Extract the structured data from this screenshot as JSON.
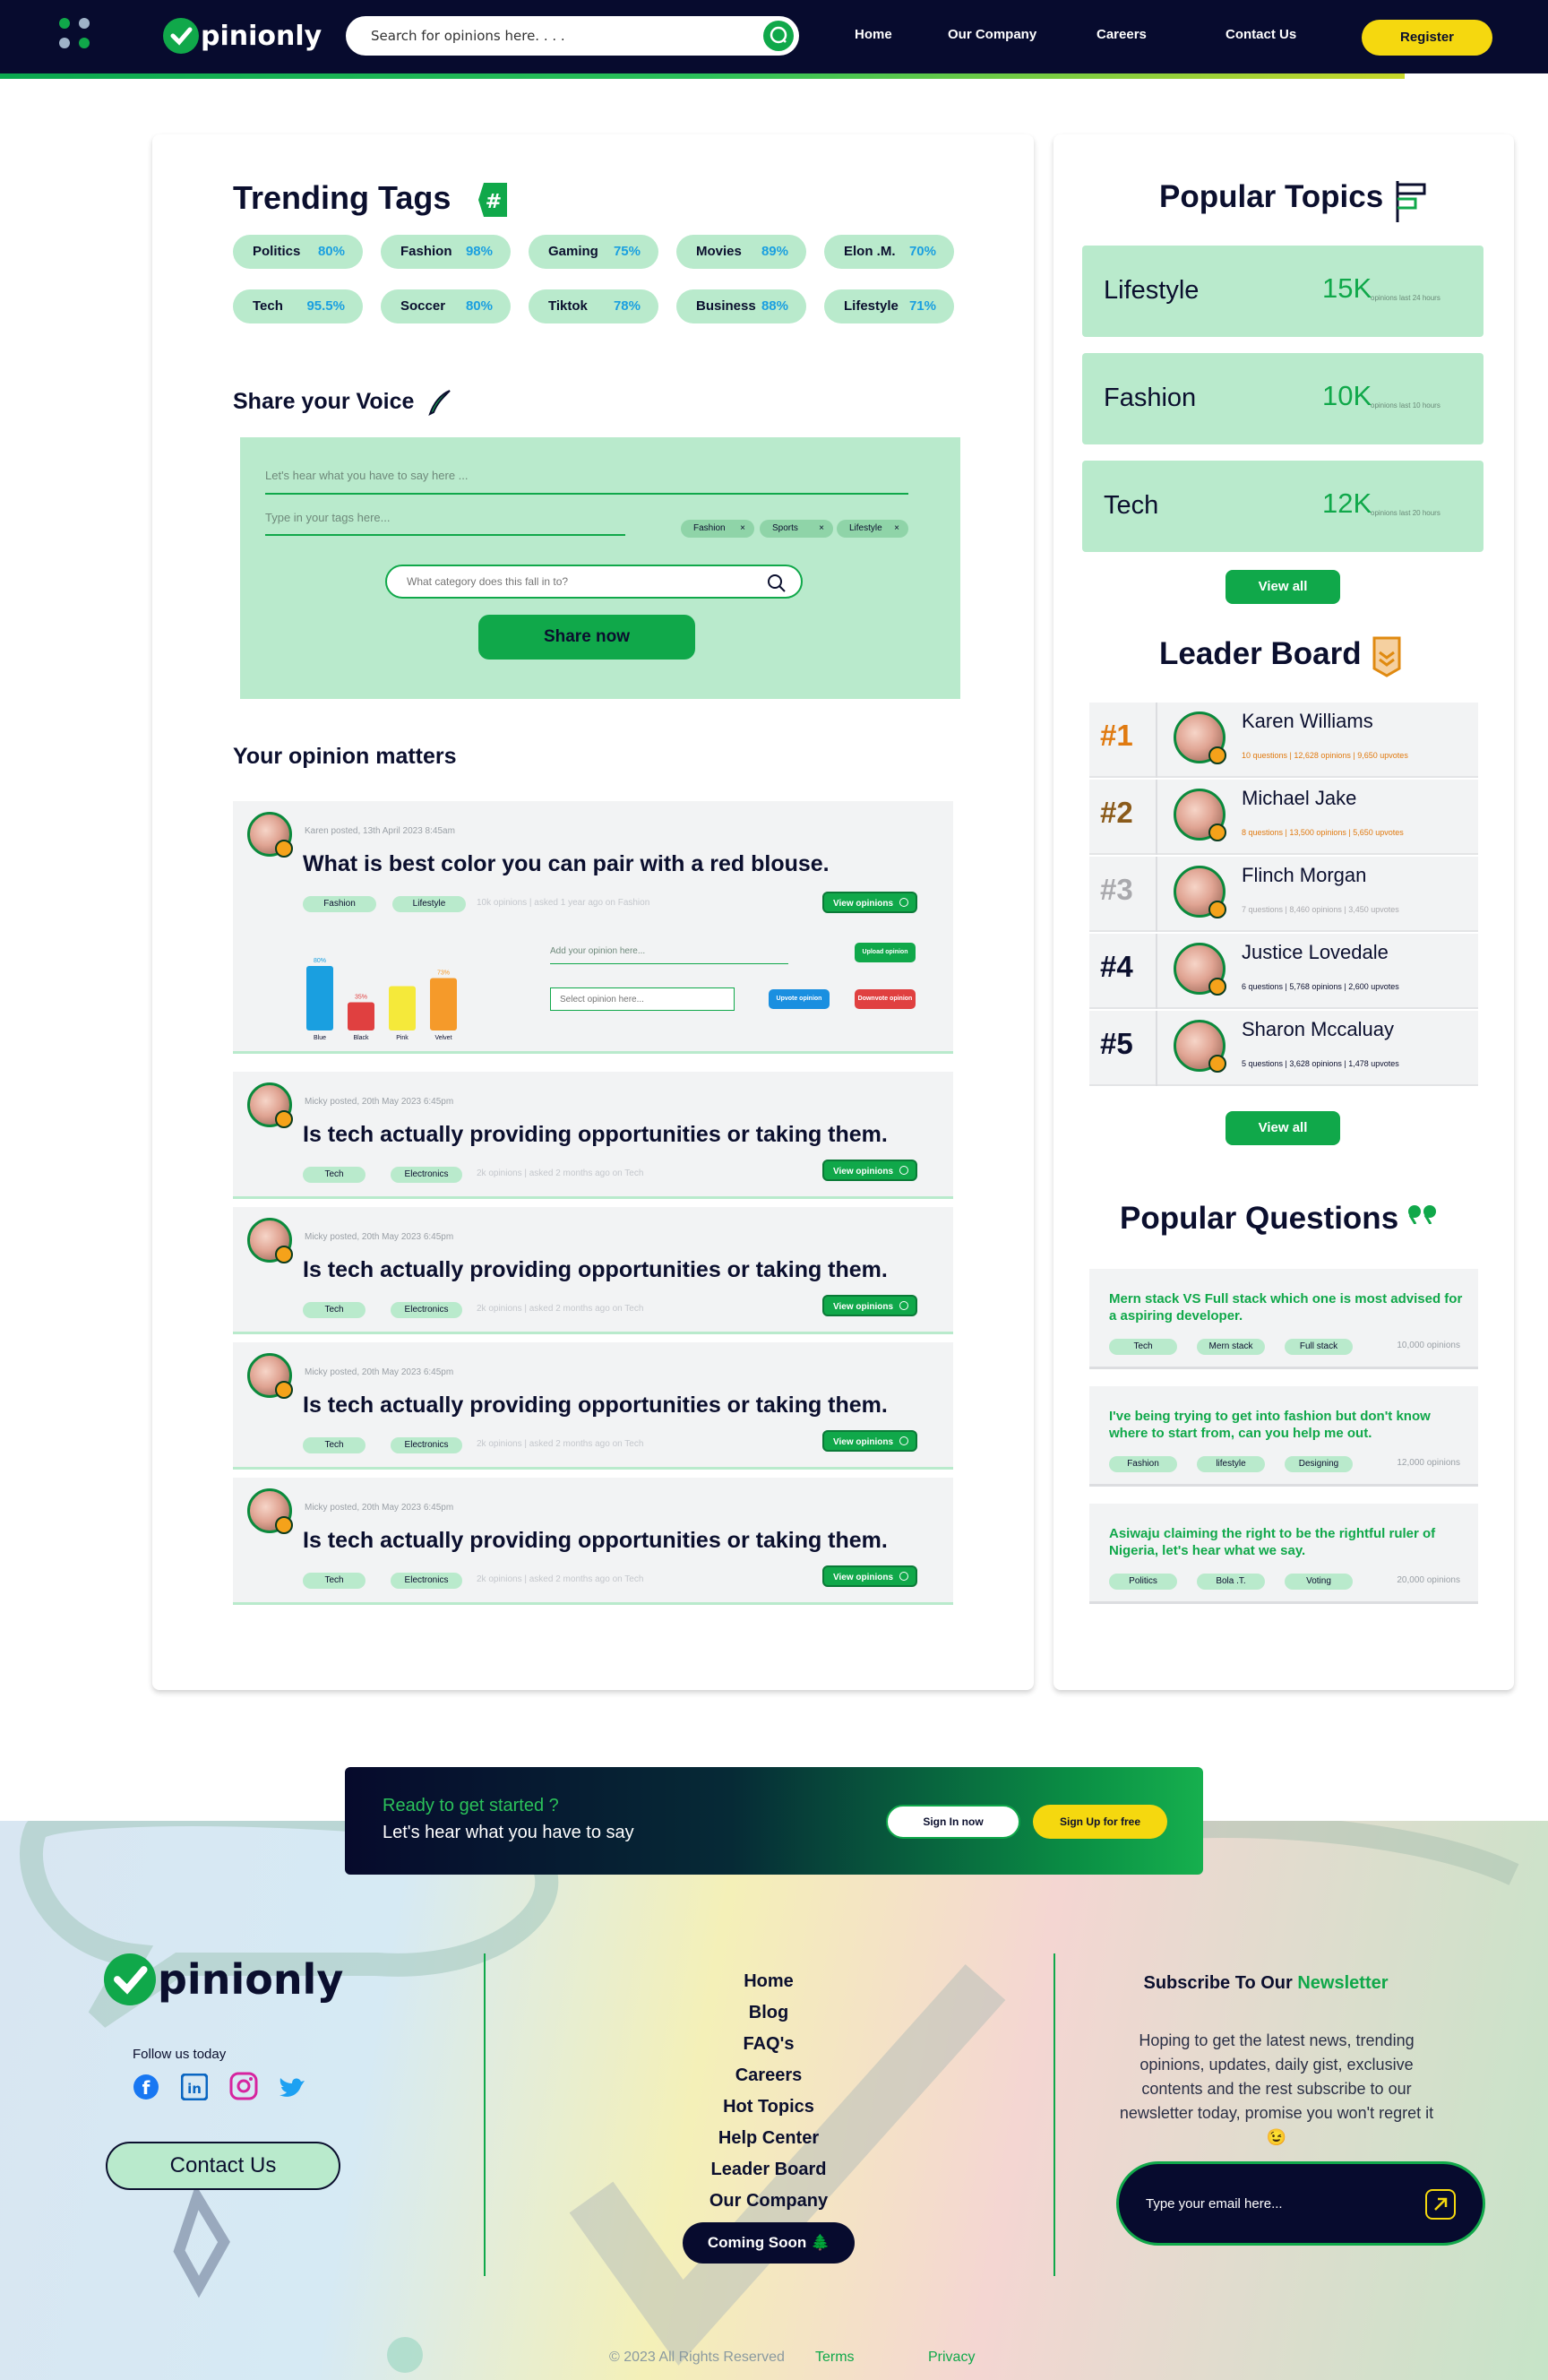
{
  "nav": {
    "brand": "pinionly",
    "search_placeholder": "Search for opinions here. . . .",
    "links": [
      "Home",
      "Our Company",
      "Careers",
      "Contact Us"
    ],
    "register": "Register",
    "accent": "#10a84a",
    "yellow": "#f5d80f",
    "dark": "#070b2e"
  },
  "trending": {
    "title": "Trending Tags",
    "title_icon": "hashtag-icon",
    "tags": [
      {
        "name": "Politics",
        "pct": "80%"
      },
      {
        "name": "Fashion",
        "pct": "98%"
      },
      {
        "name": "Gaming",
        "pct": "75%"
      },
      {
        "name": "Movies",
        "pct": "89%"
      },
      {
        "name": "Elon .M.",
        "pct": "70%"
      },
      {
        "name": "Tech",
        "pct": "95.5%"
      },
      {
        "name": "Soccer",
        "pct": "80%"
      },
      {
        "name": "Tiktok",
        "pct": "78%"
      },
      {
        "name": "Business",
        "pct": "88%"
      },
      {
        "name": "Lifestyle",
        "pct": "71%"
      }
    ]
  },
  "voice": {
    "title": "Share your Voice",
    "title_icon": "quill-pen-icon",
    "say_placeholder": "Let's hear what you have to say here ...",
    "tags_placeholder": "Type in your tags here...",
    "chips": [
      "Fashion",
      "Sports",
      "Lifestyle"
    ],
    "chip_close": "×",
    "category_placeholder": "What category does this fall in to?",
    "share": "Share now"
  },
  "opinions": {
    "title": "Your opinion matters",
    "first": {
      "meta": "Karen posted, 13th April 2023 8:45am",
      "question": "What is best color you can pair with a red blouse.",
      "tags": [
        "Fashion",
        "Lifestyle"
      ],
      "stats": "10k opinions | asked 1 year ago on Fashion",
      "view": "View opinions",
      "add_placeholder": "Add your opinion here...",
      "upload": "Upload opinion",
      "select_placeholder": "Select opinion here...",
      "upvote": "Upvote opinion",
      "downvote": "Downvote opinion"
    },
    "others": [
      {
        "meta": "Micky posted, 20th May 2023 6:45pm",
        "question": "Is tech actually providing opportunities or taking them.",
        "tags": [
          "Tech",
          "Electronics"
        ],
        "stats": "2k opinions | asked 2 months ago on Tech",
        "view": "View opinions"
      },
      {
        "meta": "Micky posted, 20th May 2023 6:45pm",
        "question": "Is tech actually providing opportunities or taking them.",
        "tags": [
          "Tech",
          "Electronics"
        ],
        "stats": "2k opinions | asked 2 months ago on Tech",
        "view": "View opinions"
      },
      {
        "meta": "Micky posted, 20th May 2023 6:45pm",
        "question": "Is tech actually providing opportunities or taking them.",
        "tags": [
          "Tech",
          "Electronics"
        ],
        "stats": "2k opinions | asked 2 months ago on Tech",
        "view": "View opinions"
      },
      {
        "meta": "Micky posted, 20th May 2023 6:45pm",
        "question": "Is tech actually providing opportunities or taking them.",
        "tags": [
          "Tech",
          "Electronics"
        ],
        "stats": "2k opinions | asked 2 months ago on Tech",
        "view": "View opinions"
      }
    ]
  },
  "chart_data": {
    "type": "bar",
    "categories": [
      "Blue",
      "Black",
      "Pink",
      "Velvet"
    ],
    "values": [
      80,
      35,
      55,
      65
    ],
    "value_labels": [
      "80%",
      "35%",
      "",
      "73%"
    ],
    "colors": [
      "#1a9fe0",
      "#e04040",
      "#f5e93a",
      "#f59a2a"
    ],
    "ylim": [
      0,
      100
    ]
  },
  "popular_topics": {
    "title": "Popular Topics",
    "title_icon": "flag-icon",
    "items": [
      {
        "name": "Lifestyle",
        "value": "15K",
        "sub": "opinions last 24 hours"
      },
      {
        "name": "Fashion",
        "value": "10K",
        "sub": "opinions last 10 hours"
      },
      {
        "name": "Tech",
        "value": "12K",
        "sub": "opinions last 20 hours"
      }
    ],
    "view_all": "View all"
  },
  "leaderboard": {
    "title": "Leader Board",
    "title_icon": "chevron-badge-icon",
    "rows": [
      {
        "rank": "#1",
        "name": "Karen Williams",
        "stats": "10 questions | 12,628 opinions | 9,650 upvotes",
        "rank_color": "#e07a10",
        "stats_color": "#e07a10"
      },
      {
        "rank": "#2",
        "name": "Michael Jake",
        "stats": "8 questions | 13,500 opinions | 5,650 upvotes",
        "rank_color": "#8a5a1a",
        "stats_color": "#e07a10"
      },
      {
        "rank": "#3",
        "name": "Flinch Morgan",
        "stats": "7 questions | 8,460 opinions | 3,450 upvotes",
        "rank_color": "#a9a9ad",
        "stats_color": "#a9a9ad"
      },
      {
        "rank": "#4",
        "name": "Justice Lovedale",
        "stats": "6 questions | 5,768 opinions | 2,600 upvotes",
        "rank_color": "#0b0f2e",
        "stats_color": "#0b0f2e"
      },
      {
        "rank": "#5",
        "name": "Sharon Mccaluay",
        "stats": "5 questions | 3,628 opinions | 1,478 upvotes",
        "rank_color": "#0b0f2e",
        "stats_color": "#0b0f2e"
      }
    ],
    "view_all": "View all"
  },
  "popular_questions": {
    "title": "Popular Questions",
    "title_icon": "quote-icon",
    "items": [
      {
        "question": "Mern stack VS Full stack which one is most advised for a aspiring developer.",
        "tags": [
          "Tech",
          "Mern stack",
          "Full stack"
        ],
        "count": "10,000 opinions"
      },
      {
        "question": "I've being trying to get into fashion but don't know where to start from, can you help me out.",
        "tags": [
          "Fashion",
          "lifestyle",
          "Designing"
        ],
        "count": "12,000 opinions"
      },
      {
        "question": "Asiwaju claiming the right to be the rightful ruler of Nigeria, let's hear what we say.",
        "tags": [
          "Politics",
          "Bola .T.",
          "Voting"
        ],
        "count": "20,000 opinions"
      }
    ]
  },
  "cta": {
    "line1": "Ready to get started ?",
    "line2": "Let's hear what you have to say",
    "signin": "Sign In now",
    "signup": "Sign Up for free"
  },
  "footer": {
    "brand": "pinionly",
    "follow": "Follow us today",
    "socials": [
      "facebook-icon",
      "linkedin-icon",
      "instagram-icon",
      "twitter-icon"
    ],
    "contact": "Contact Us",
    "links": [
      "Home",
      "Blog",
      "FAQ's",
      "Careers",
      "Hot Topics",
      "Help Center",
      "Leader Board",
      "Our Company"
    ],
    "coming_soon": "Coming Soon 🌲",
    "subscribe_prefix": "Subscribe To Our ",
    "subscribe_accent": "Newsletter",
    "subscribe_text": "Hoping to get the latest news, trending opinions, updates, daily gist, exclusive contents and the rest subscribe to our newsletter today, promise you won't regret it 😉",
    "email_placeholder": "Type your email here...",
    "copyright": "© 2023 All Rights Reserved",
    "terms": "Terms",
    "privacy": "Privacy"
  }
}
